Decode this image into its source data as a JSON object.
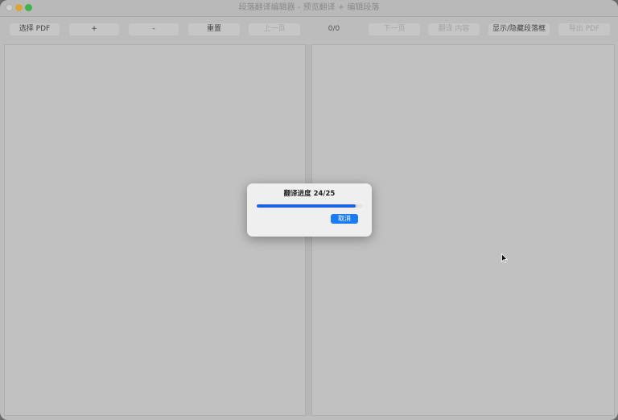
{
  "window": {
    "title": "段落翻译编辑器 - 预览翻译 + 编辑段落"
  },
  "toolbar": {
    "select_pdf": "选择 PDF",
    "zoom_in": "+",
    "zoom_out": "-",
    "reset": "重置",
    "prev_page": "上一页",
    "page_indicator": "0/0",
    "next_page": "下一页",
    "translate_page": "翻译 内容",
    "toggle_boxes": "显示/隐藏段落框",
    "export_pdf": "导出 PDF"
  },
  "dialog": {
    "title": "翻译进度 24/25",
    "progress": 0.96,
    "cancel_label": "取消"
  },
  "colors": {
    "accent": "#1a7cf5",
    "progress": "#1a63e0"
  }
}
